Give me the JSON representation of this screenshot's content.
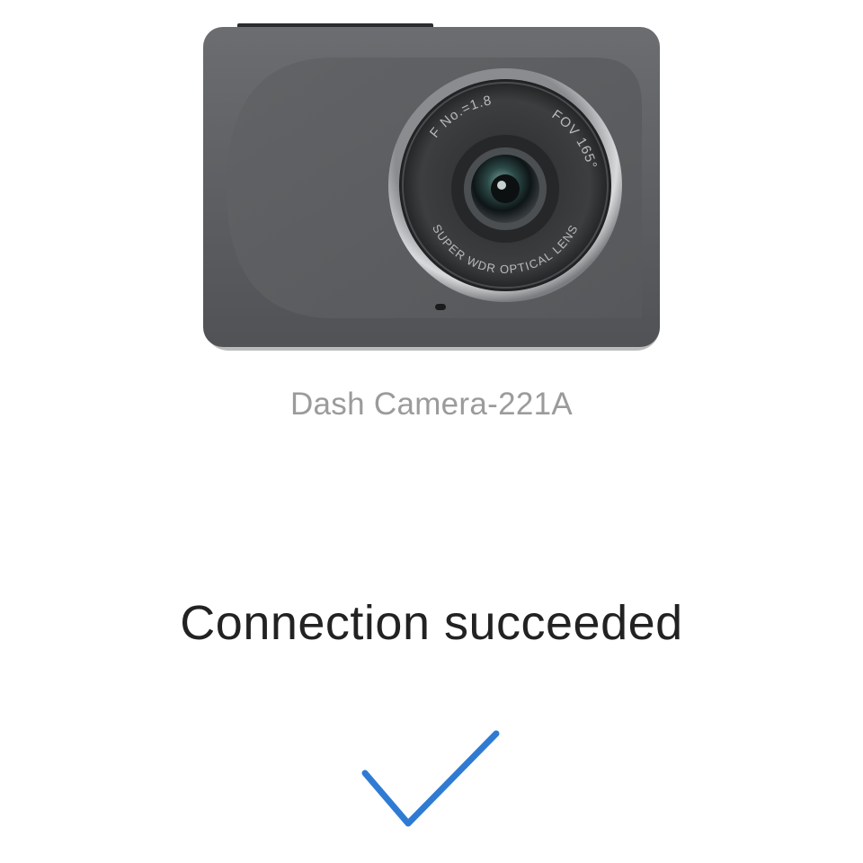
{
  "device": {
    "name": "Dash Camera-221A",
    "image_icon": "dash-camera-illustration",
    "lens_markings": {
      "aperture": "F No.=1.8",
      "fov": "FOV 165°",
      "lens_type": "SUPER WDR OPTICAL LENS"
    }
  },
  "status": {
    "message": "Connection succeeded",
    "icon": "checkmark-icon",
    "icon_color": "#2f7bd4"
  },
  "colors": {
    "background": "#ffffff",
    "device_name_text": "#9b9b9b",
    "status_text": "#222222",
    "camera_body": "#5b5d60"
  }
}
